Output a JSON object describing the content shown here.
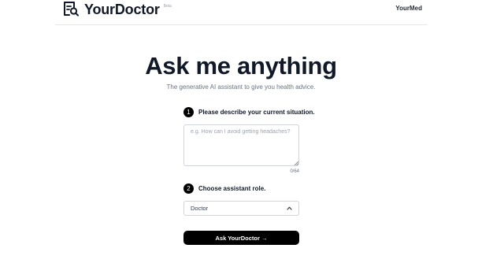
{
  "header": {
    "brand_name": "YourDoctor",
    "beta_label": "Beta",
    "brand_icon": "search-document-icon",
    "nav_link": "YourMed"
  },
  "hero": {
    "title": "Ask me anything",
    "subtitle": "The generative AI assistant to give you health advice."
  },
  "step1": {
    "number": "1",
    "label": "Please describe your current situation.",
    "input_value": "",
    "placeholder": "e.g. How can I avoid getting headaches?",
    "counter": "0/64"
  },
  "step2": {
    "number": "2",
    "label": "Choose assistant role.",
    "selected_role": "Doctor",
    "chevron_icon": "chevron-up-icon"
  },
  "cta": {
    "label": "Ask YourDoctor →"
  }
}
